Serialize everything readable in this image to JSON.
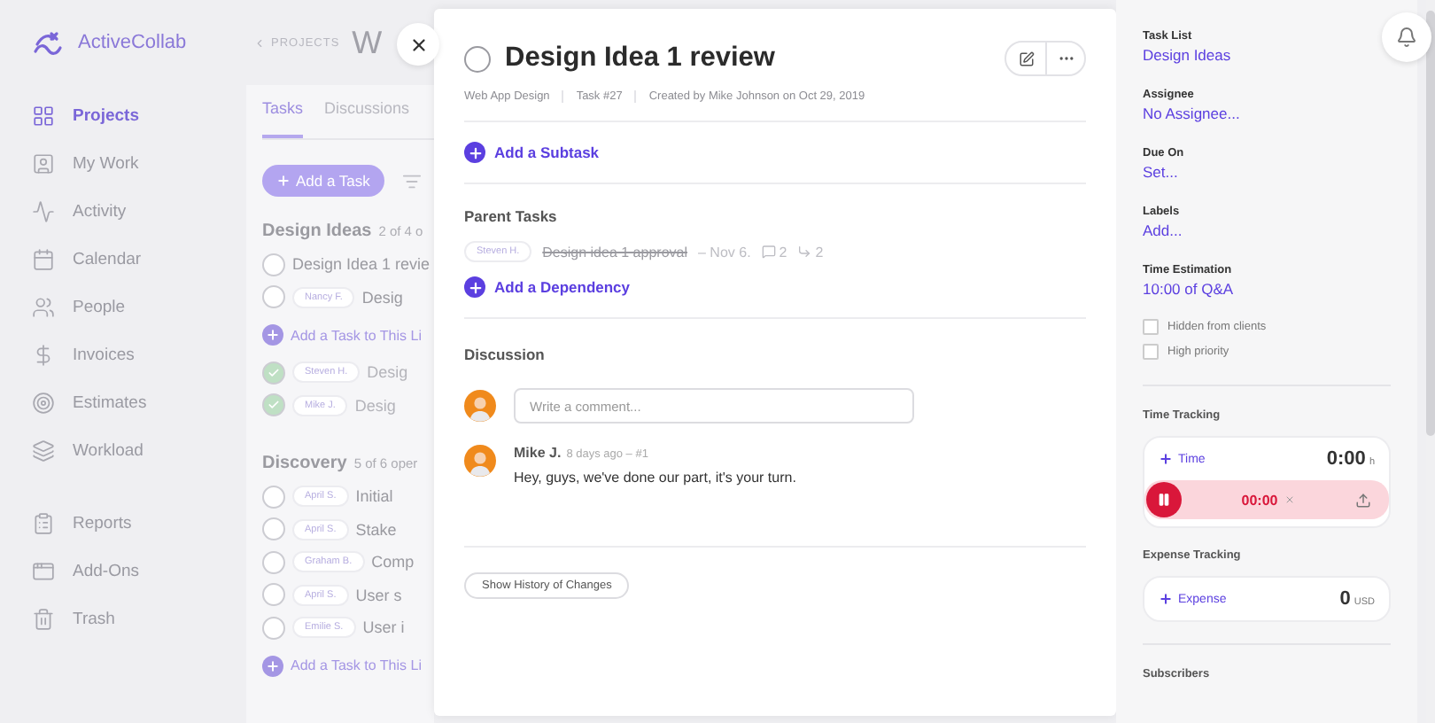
{
  "sidebar": {
    "logo": "ActiveCollab",
    "nav_items": [
      {
        "label": "Projects",
        "selected": true
      },
      {
        "label": "My Work",
        "selected": false
      },
      {
        "label": "Activity",
        "selected": false
      },
      {
        "label": "Calendar",
        "selected": false
      },
      {
        "label": "People",
        "selected": false
      },
      {
        "label": "Invoices",
        "selected": false
      },
      {
        "label": "Estimates",
        "selected": false
      },
      {
        "label": "Workload",
        "selected": false
      }
    ],
    "tool_items": [
      {
        "label": "Reports",
        "selected": false
      },
      {
        "label": "Add-Ons",
        "selected": false
      },
      {
        "label": "Trash",
        "selected": false
      }
    ]
  },
  "project": {
    "breadcrumb": "PROJECTS",
    "title": "W",
    "tabs": [
      {
        "label": "Tasks",
        "selected": true
      },
      {
        "label": "Discussions",
        "selected": false
      }
    ],
    "add_button": "Add a Task",
    "task_lists": [
      {
        "name": "Design Ideas",
        "count": "2 of 4 o",
        "open_tasks": [
          {
            "title": "Design Idea 1 revie",
            "done": false
          },
          {
            "assignee": "Nancy F.",
            "title": "Desig",
            "done": false
          }
        ],
        "add_label": "Add a Task to This Li",
        "done_tasks": [
          {
            "assignee": "Steven H.",
            "title": "Desig",
            "done": true
          },
          {
            "assignee": "Mike J.",
            "title": "Desig",
            "done": true
          }
        ]
      },
      {
        "name": "Discovery",
        "count": "5 of 6 oper",
        "open_tasks": [
          {
            "assignee": "April S.",
            "title": "Initial",
            "done": false
          },
          {
            "assignee": "April S.",
            "title": "Stake",
            "done": false
          },
          {
            "assignee": "Graham B.",
            "title": "Comp",
            "done": false
          },
          {
            "assignee": "April S.",
            "title": "User s",
            "done": false
          },
          {
            "assignee": "Emilie S.",
            "title": "User i",
            "done": false
          }
        ],
        "add_label": "Add a Task to This Li"
      }
    ]
  },
  "task": {
    "title": "Design Idea 1 review",
    "done": false,
    "meta": [
      "Web App Design",
      "Task #27",
      "Created by Mike Johnson on Oct 29, 2019"
    ],
    "add_subtask": "Add a Subtask",
    "parent_tasks": {
      "heading": "Parent Tasks",
      "items": [
        {
          "assignee": "Steven H.",
          "title": "Design idea 1 approval",
          "completed": true,
          "due": "– Nov 6.",
          "comments": "2",
          "subtasks": "2"
        }
      ],
      "add_label": "Add a Dependency"
    },
    "discussion": {
      "heading": "Discussion",
      "placeholder": "Write a comment...",
      "comments": [
        {
          "author": "Mike J.",
          "meta": "8 days ago – #1",
          "text": "Hey, guys, we've done our part, it's your turn."
        }
      ]
    },
    "history_button": "Show History of Changes"
  },
  "details": {
    "fields": [
      {
        "label": "Task List",
        "value": "Design Ideas"
      },
      {
        "label": "Assignee",
        "value": "No Assignee..."
      },
      {
        "label": "Due On",
        "value": "Set..."
      },
      {
        "label": "Labels",
        "value": "Add..."
      },
      {
        "label": "Time Estimation",
        "value": "10:00 of Q&A"
      }
    ],
    "checkboxes": [
      {
        "label": "Hidden from clients",
        "checked": false
      },
      {
        "label": "High priority",
        "checked": false
      }
    ],
    "time_tracking": {
      "heading": "Time Tracking",
      "add_label": "Time",
      "total": "0:00",
      "unit": "h",
      "timer": {
        "time": "00:00",
        "running": true
      }
    },
    "expense_tracking": {
      "heading": "Expense Tracking",
      "add_label": "Expense",
      "total": "0",
      "unit": "USD"
    },
    "subscribers": {
      "heading": "Subscribers"
    }
  }
}
